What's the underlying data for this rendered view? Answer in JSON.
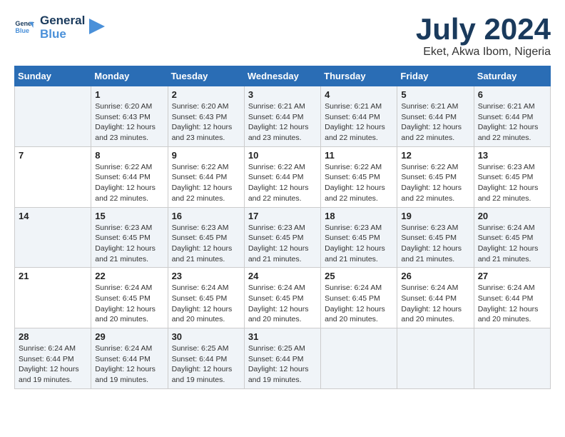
{
  "header": {
    "logo_line1": "General",
    "logo_line2": "Blue",
    "month_title": "July 2024",
    "location": "Eket, Akwa Ibom, Nigeria"
  },
  "days_of_week": [
    "Sunday",
    "Monday",
    "Tuesday",
    "Wednesday",
    "Thursday",
    "Friday",
    "Saturday"
  ],
  "weeks": [
    [
      {
        "day": "",
        "info": ""
      },
      {
        "day": "1",
        "info": "Sunrise: 6:20 AM\nSunset: 6:43 PM\nDaylight: 12 hours\nand 23 minutes."
      },
      {
        "day": "2",
        "info": "Sunrise: 6:20 AM\nSunset: 6:43 PM\nDaylight: 12 hours\nand 23 minutes."
      },
      {
        "day": "3",
        "info": "Sunrise: 6:21 AM\nSunset: 6:44 PM\nDaylight: 12 hours\nand 23 minutes."
      },
      {
        "day": "4",
        "info": "Sunrise: 6:21 AM\nSunset: 6:44 PM\nDaylight: 12 hours\nand 22 minutes."
      },
      {
        "day": "5",
        "info": "Sunrise: 6:21 AM\nSunset: 6:44 PM\nDaylight: 12 hours\nand 22 minutes."
      },
      {
        "day": "6",
        "info": "Sunrise: 6:21 AM\nSunset: 6:44 PM\nDaylight: 12 hours\nand 22 minutes."
      }
    ],
    [
      {
        "day": "7",
        "info": ""
      },
      {
        "day": "8",
        "info": "Sunrise: 6:22 AM\nSunset: 6:44 PM\nDaylight: 12 hours\nand 22 minutes."
      },
      {
        "day": "9",
        "info": "Sunrise: 6:22 AM\nSunset: 6:44 PM\nDaylight: 12 hours\nand 22 minutes."
      },
      {
        "day": "10",
        "info": "Sunrise: 6:22 AM\nSunset: 6:44 PM\nDaylight: 12 hours\nand 22 minutes."
      },
      {
        "day": "11",
        "info": "Sunrise: 6:22 AM\nSunset: 6:45 PM\nDaylight: 12 hours\nand 22 minutes."
      },
      {
        "day": "12",
        "info": "Sunrise: 6:22 AM\nSunset: 6:45 PM\nDaylight: 12 hours\nand 22 minutes."
      },
      {
        "day": "13",
        "info": "Sunrise: 6:23 AM\nSunset: 6:45 PM\nDaylight: 12 hours\nand 22 minutes."
      }
    ],
    [
      {
        "day": "14",
        "info": ""
      },
      {
        "day": "15",
        "info": "Sunrise: 6:23 AM\nSunset: 6:45 PM\nDaylight: 12 hours\nand 21 minutes."
      },
      {
        "day": "16",
        "info": "Sunrise: 6:23 AM\nSunset: 6:45 PM\nDaylight: 12 hours\nand 21 minutes."
      },
      {
        "day": "17",
        "info": "Sunrise: 6:23 AM\nSunset: 6:45 PM\nDaylight: 12 hours\nand 21 minutes."
      },
      {
        "day": "18",
        "info": "Sunrise: 6:23 AM\nSunset: 6:45 PM\nDaylight: 12 hours\nand 21 minutes."
      },
      {
        "day": "19",
        "info": "Sunrise: 6:23 AM\nSunset: 6:45 PM\nDaylight: 12 hours\nand 21 minutes."
      },
      {
        "day": "20",
        "info": "Sunrise: 6:24 AM\nSunset: 6:45 PM\nDaylight: 12 hours\nand 21 minutes."
      }
    ],
    [
      {
        "day": "21",
        "info": ""
      },
      {
        "day": "22",
        "info": "Sunrise: 6:24 AM\nSunset: 6:45 PM\nDaylight: 12 hours\nand 20 minutes."
      },
      {
        "day": "23",
        "info": "Sunrise: 6:24 AM\nSunset: 6:45 PM\nDaylight: 12 hours\nand 20 minutes."
      },
      {
        "day": "24",
        "info": "Sunrise: 6:24 AM\nSunset: 6:45 PM\nDaylight: 12 hours\nand 20 minutes."
      },
      {
        "day": "25",
        "info": "Sunrise: 6:24 AM\nSunset: 6:45 PM\nDaylight: 12 hours\nand 20 minutes."
      },
      {
        "day": "26",
        "info": "Sunrise: 6:24 AM\nSunset: 6:44 PM\nDaylight: 12 hours\nand 20 minutes."
      },
      {
        "day": "27",
        "info": "Sunrise: 6:24 AM\nSunset: 6:44 PM\nDaylight: 12 hours\nand 20 minutes."
      }
    ],
    [
      {
        "day": "28",
        "info": "Sunrise: 6:24 AM\nSunset: 6:44 PM\nDaylight: 12 hours\nand 19 minutes."
      },
      {
        "day": "29",
        "info": "Sunrise: 6:24 AM\nSunset: 6:44 PM\nDaylight: 12 hours\nand 19 minutes."
      },
      {
        "day": "30",
        "info": "Sunrise: 6:25 AM\nSunset: 6:44 PM\nDaylight: 12 hours\nand 19 minutes."
      },
      {
        "day": "31",
        "info": "Sunrise: 6:25 AM\nSunset: 6:44 PM\nDaylight: 12 hours\nand 19 minutes."
      },
      {
        "day": "",
        "info": ""
      },
      {
        "day": "",
        "info": ""
      },
      {
        "day": "",
        "info": ""
      }
    ]
  ]
}
